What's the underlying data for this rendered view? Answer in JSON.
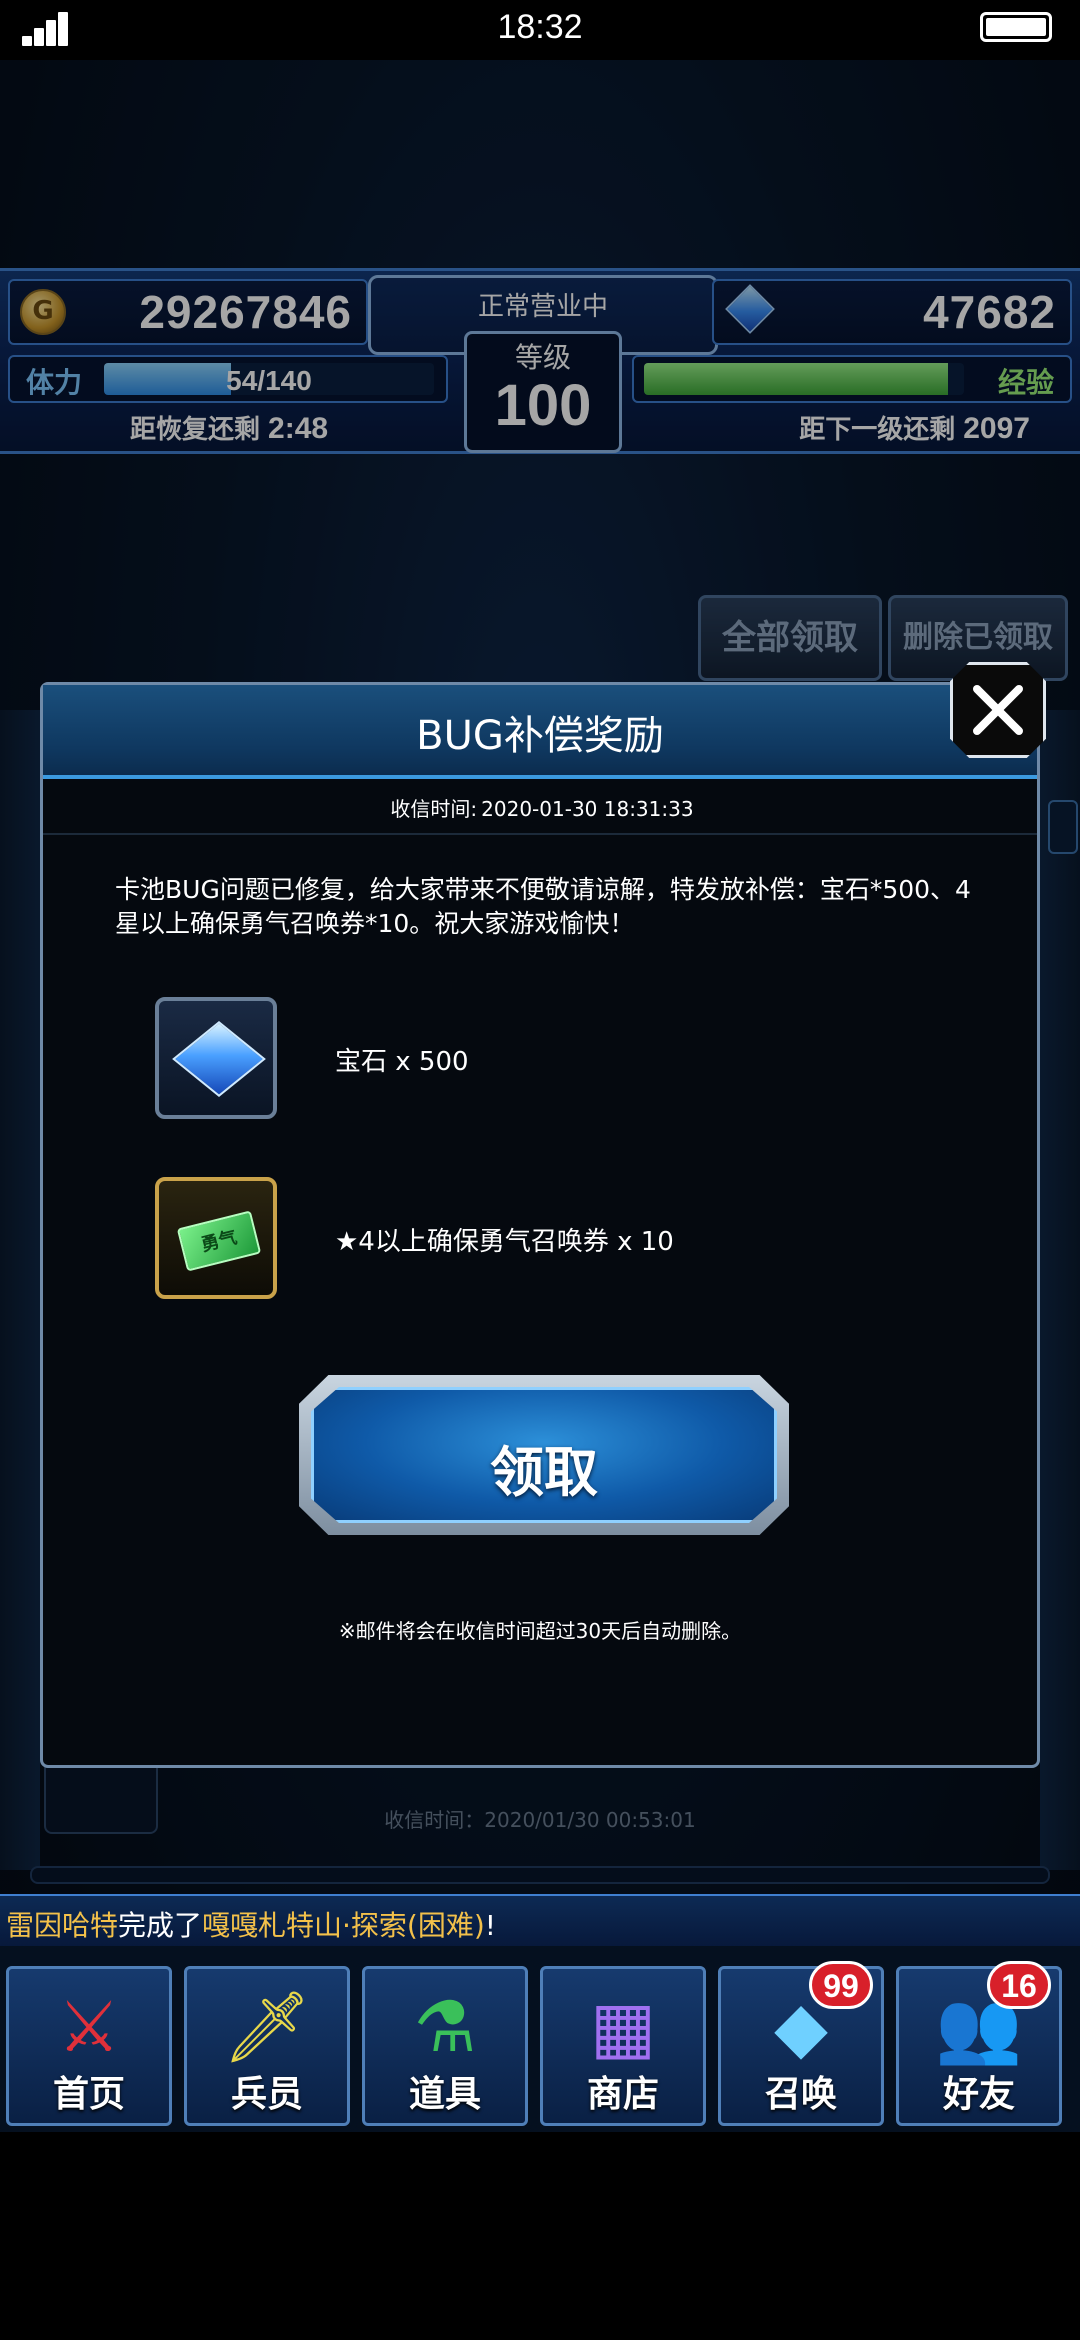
{
  "status_bar": {
    "time": "18:32"
  },
  "hud": {
    "gil": "29267846",
    "gems": "47682",
    "shop_status": "正常营业中",
    "level_label": "等级",
    "level": "100",
    "stamina_label": "体力",
    "stamina": "54/140",
    "stamina_fraction": 0.386,
    "exp_label": "经验",
    "exp_fraction": 0.95,
    "recover_label": "距恢复还剩",
    "recover_time": "2:48",
    "next_level_label": "距下一级还剩",
    "next_level_value": "2097"
  },
  "background": {
    "claim_all": "全部领取",
    "delete_claimed": "删除已领取",
    "mail_time": "收信时间：2020/01/30 00:53:01"
  },
  "modal": {
    "title": "BUG补偿奖励",
    "recv_label": "收信时间:",
    "recv_time": "2020-01-30 18:31:33",
    "body": "卡池BUG问题已修复，给大家带来不便敬请谅解，特发放补偿：宝石*500、4星以上确保勇气召唤券*10。祝大家游戏愉快！",
    "rewards": [
      {
        "icon": "gem-icon",
        "label": "宝石 x 500"
      },
      {
        "icon": "summon-ticket-icon",
        "label": "★4以上确保勇气召唤券 x 10"
      }
    ],
    "claim_label": "领取",
    "notice": "※邮件将会在收信时间超过30天后自动删除。"
  },
  "ticker": {
    "player": "雷因哈特",
    "middle": "完成了",
    "quest": "嘎嘎札特山·探索(困难)",
    "end": "!"
  },
  "nav": [
    {
      "label": "首页",
      "icon": "sword-icon"
    },
    {
      "label": "兵员",
      "icon": "unit-icon"
    },
    {
      "label": "道具",
      "icon": "potion-icon"
    },
    {
      "label": "商店",
      "icon": "shop-icon"
    },
    {
      "label": "召唤",
      "icon": "crystal-icon",
      "badge": "99"
    },
    {
      "label": "好友",
      "icon": "friends-icon",
      "badge": "16"
    }
  ],
  "colors": {
    "accent": "#3b9ae0",
    "badge": "#d8202a",
    "highlight_name": "#f3c14a"
  }
}
